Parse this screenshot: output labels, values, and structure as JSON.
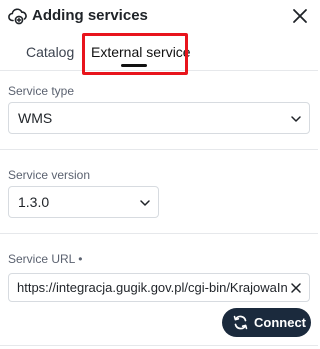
{
  "header": {
    "title": "Adding services",
    "icon": "cloud-add-icon",
    "close_icon": "close-icon"
  },
  "tabs": [
    {
      "label": "Catalog",
      "active": false
    },
    {
      "label": "External service",
      "active": true
    }
  ],
  "form": {
    "service_type": {
      "label": "Service type",
      "value": "WMS"
    },
    "service_version": {
      "label": "Service version",
      "value": "1.3.0"
    },
    "service_url": {
      "label": "Service URL •",
      "value": "https://integracja.gugik.gov.pl/cgi-bin/KrajowaIntegracja"
    }
  },
  "actions": {
    "connect_label": "Connect",
    "connect_icon": "refresh-icon"
  },
  "colors": {
    "highlight": "#e8141c",
    "button_bg": "#1b2a3d",
    "text": "#1f2328",
    "label": "#5b6270",
    "border": "#d7dbe0"
  }
}
